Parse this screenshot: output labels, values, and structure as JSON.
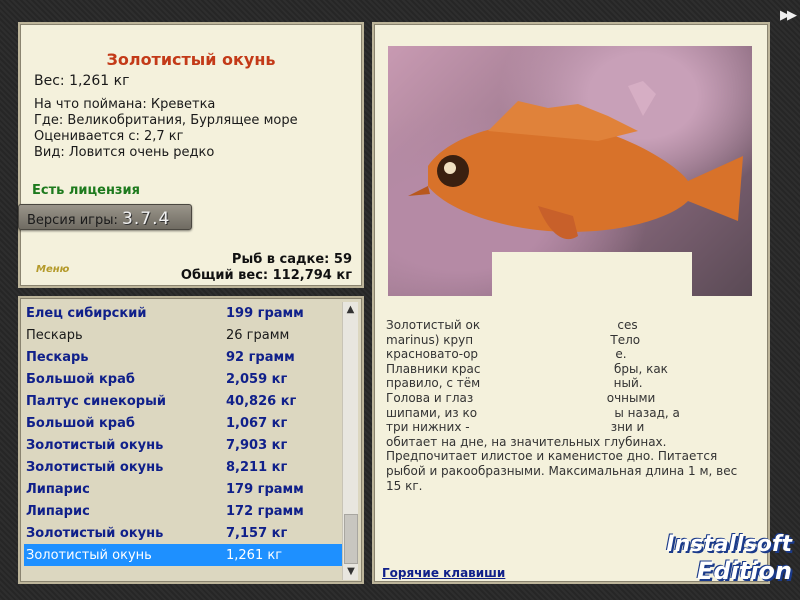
{
  "info": {
    "fish_name": "Золотистый окунь",
    "weight": "Вес: 1,261 кг",
    "caught_on": "На что поймана: Креветка",
    "location": "Где: Великобритания, Бурлящее море",
    "valued_from": "Оценивается с: 2,7 кг",
    "rarity": "Вид: Ловится очень редко",
    "license": "Есть лицензия",
    "version_label": "Версия игры:",
    "version_number": "3.7.4",
    "menu_link": "Меню",
    "fish_in_cage": "Рыб в садке: 59",
    "total_weight": "Общий вес: 112,794 кг"
  },
  "catches": [
    {
      "name": "Елец сибирский",
      "weight": "199 грамм"
    },
    {
      "name": "Пескарь",
      "weight": "26 грамм"
    },
    {
      "name": "Пескарь",
      "weight": "92 грамм"
    },
    {
      "name": "Большой краб",
      "weight": "2,059 кг"
    },
    {
      "name": "Палтус синекорый",
      "weight": "40,826 кг"
    },
    {
      "name": "Большой краб",
      "weight": "1,067 кг"
    },
    {
      "name": "Золотистый окунь",
      "weight": "7,903 кг"
    },
    {
      "name": "Золотистый окунь",
      "weight": "8,211 кг"
    },
    {
      "name": "Липарис",
      "weight": "179 грамм"
    },
    {
      "name": "Липарис",
      "weight": "172 грамм"
    },
    {
      "name": "Золотистый окунь",
      "weight": "7,157 кг"
    },
    {
      "name": "Золотистый окунь",
      "weight": "1,261 кг"
    }
  ],
  "detail": {
    "description_lines": [
      "Золотистый ок                                    ces",
      "marinus) круп                                    Тело",
      "красновато-ор                                    е.",
      "Плавники крас                                   бры, как",
      "правило, с тём                                   ный.",
      "Голова и глаз                                   очными",
      "шипами, из ко                                    ы назад, а",
      "три нижних -                                     зни и",
      "обитает на дне, на значительных глубинах.",
      "Предпочитает илистое и каменистое дно. Питается",
      "рыбой и ракообразными. Максимальная длина 1 м, вес",
      "15 кг."
    ],
    "hotkeys": "Горячие клавиши"
  },
  "watermark": {
    "line1": "Installsoft",
    "line2": "Edition"
  },
  "colors": {
    "title": "#c33a18",
    "license": "#1d7a1d",
    "link": "#10208a",
    "selection": "#1e90ff"
  }
}
